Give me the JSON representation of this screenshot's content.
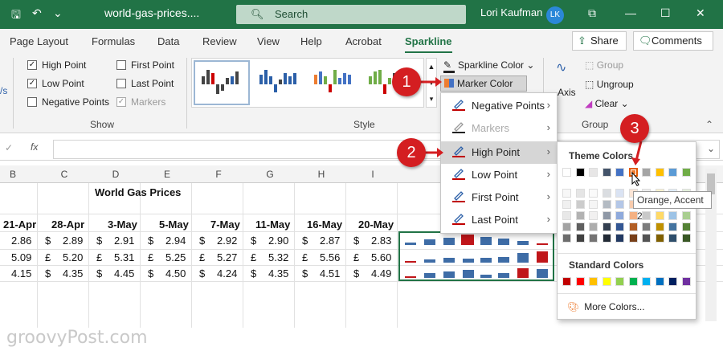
{
  "titlebar": {
    "filename": "world-gas-prices....",
    "search": "Search",
    "user": "Lori Kaufman",
    "initials": "LK"
  },
  "tabs": [
    "Page Layout",
    "Formulas",
    "Data",
    "Review",
    "View",
    "Help",
    "Acrobat",
    "Sparkline"
  ],
  "buttons": {
    "share": "Share",
    "comments": "Comments"
  },
  "show_group": {
    "label": "Show",
    "items": [
      {
        "label": "High Point",
        "checked": true
      },
      {
        "label": "Low Point",
        "checked": true
      },
      {
        "label": "Negative Points",
        "checked": false
      },
      {
        "label": "First Point",
        "checked": false
      },
      {
        "label": "Last Point",
        "checked": false
      },
      {
        "label": "Markers",
        "checked": true
      }
    ]
  },
  "style_group": {
    "label": "Style",
    "sparkline_color": "Sparkline Color",
    "marker_color": "Marker Color"
  },
  "group_group": {
    "label": "Group",
    "group": "Group",
    "ungroup": "Ungroup",
    "clear": "Clear",
    "axis": "Axis"
  },
  "sheet": {
    "columns": [
      "B",
      "C",
      "D",
      "E",
      "F",
      "G",
      "H",
      "I"
    ],
    "title": "World Gas Prices",
    "dates": [
      "21-Apr",
      "28-Apr",
      "3-May",
      "5-May",
      "7-May",
      "11-May",
      "16-May",
      "20-May"
    ],
    "rows": [
      {
        "b": "2.86",
        "vals": [
          "$",
          "2.89",
          "$",
          "2.91",
          "$",
          "2.94",
          "$",
          "2.92",
          "$",
          "2.90",
          "$",
          "2.87",
          "$",
          "2.83"
        ]
      },
      {
        "b": "5.09",
        "vals": [
          "£",
          "5.20",
          "£",
          "5.31",
          "£",
          "5.25",
          "£",
          "5.27",
          "£",
          "5.32",
          "£",
          "5.56",
          "£",
          "5.60"
        ]
      },
      {
        "b": "4.15",
        "vals": [
          "$",
          "4.35",
          "$",
          "4.45",
          "$",
          "4.50",
          "$",
          "4.24",
          "$",
          "4.35",
          "$",
          "4.51",
          "$",
          "4.49"
        ]
      }
    ]
  },
  "menu": {
    "items": [
      {
        "label": "Negative Points",
        "disabled": false,
        "highlighted": false
      },
      {
        "label": "Markers",
        "disabled": true,
        "highlighted": false
      },
      {
        "label": "High Point",
        "disabled": false,
        "highlighted": true
      },
      {
        "label": "Low Point",
        "disabled": false,
        "highlighted": false
      },
      {
        "label": "First Point",
        "disabled": false,
        "highlighted": false
      },
      {
        "label": "Last Point",
        "disabled": false,
        "highlighted": false
      }
    ]
  },
  "palette": {
    "theme_label": "Theme Colors",
    "standard_label": "Standard Colors",
    "more": "More Colors...",
    "tooltip": "Orange, Accent 2",
    "theme_colors": [
      "#ffffff",
      "#000000",
      "#e7e6e6",
      "#44546a",
      "#4472c4",
      "#ed7d31",
      "#a5a5a5",
      "#ffc000",
      "#5b9bd5",
      "#70ad47"
    ],
    "standard_colors": [
      "#c00000",
      "#ff0000",
      "#ffc000",
      "#ffff00",
      "#92d050",
      "#00b050",
      "#00b0f0",
      "#0070c0",
      "#002060",
      "#7030a0"
    ]
  },
  "badges": [
    "1",
    "2",
    "3"
  ],
  "watermark": "groovyPost.com"
}
